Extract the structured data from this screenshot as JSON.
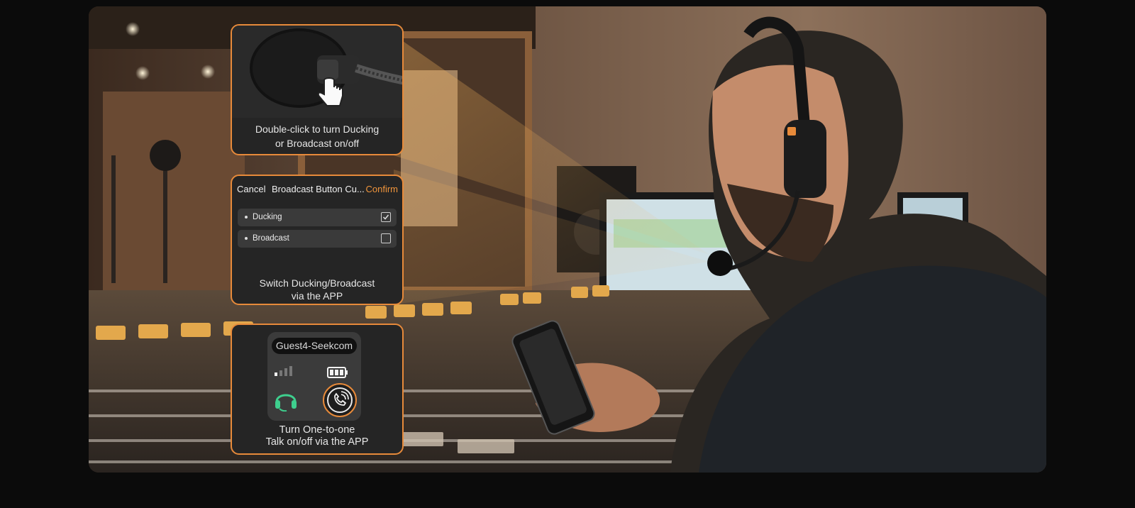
{
  "card_mic": {
    "caption_line1": "Double-click to turn Ducking",
    "caption_line2": "or Broadcast on/off"
  },
  "card_app": {
    "cancel_label": "Cancel",
    "title": "Broadcast Button Cu...",
    "confirm_label": "Confirm",
    "options": [
      {
        "label": "Ducking",
        "checked": true
      },
      {
        "label": "Broadcast",
        "checked": false
      }
    ],
    "caption_line1": "Switch Ducking/Broadcast",
    "caption_line2": "via the APP"
  },
  "card_device": {
    "device_name": "Guest4-Seekcom",
    "caption_line1": "Turn One-to-one",
    "caption_line2": "Talk on/off via the APP"
  },
  "colors": {
    "accent": "#e78a3a",
    "card_bg": "#252525",
    "headset_icon": "#3ecf8e"
  },
  "icons": [
    "microphone-image",
    "tap-hand-icon",
    "checkbox-checked",
    "checkbox-unchecked",
    "signal-icon",
    "battery-icon",
    "headset-icon",
    "one-to-one-talk-icon"
  ]
}
